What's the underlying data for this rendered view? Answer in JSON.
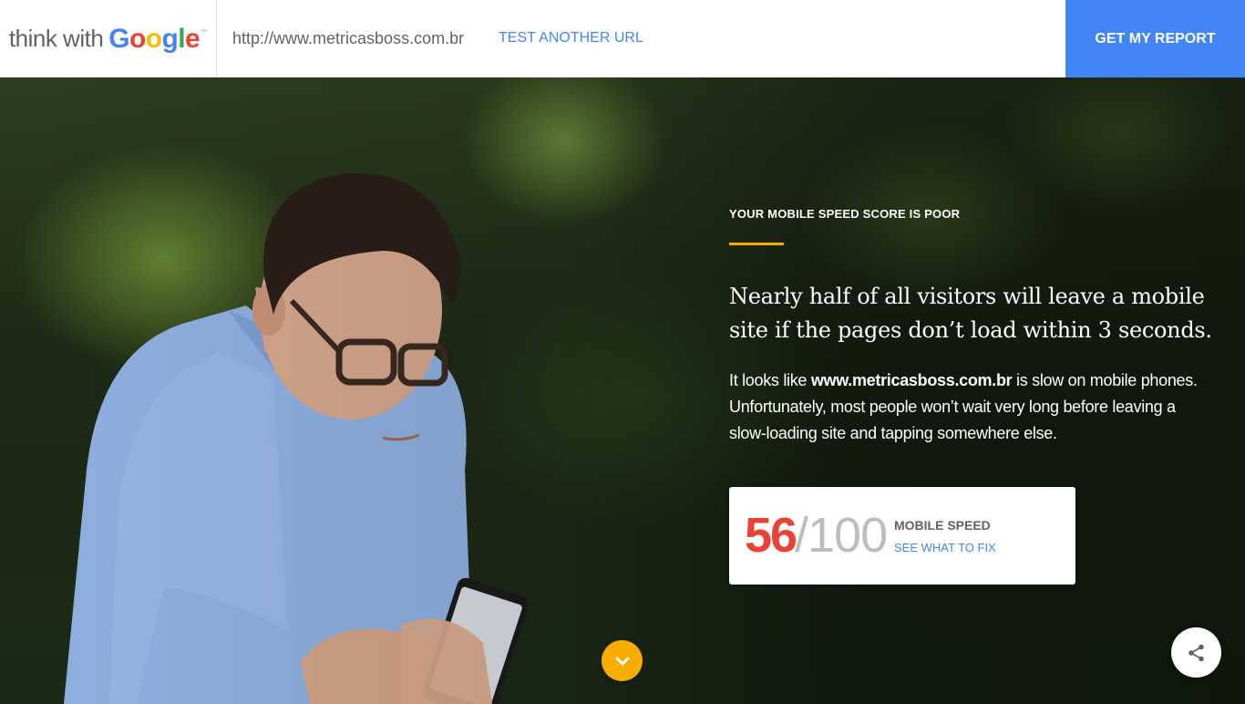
{
  "header": {
    "brand_prefix": "think with",
    "brand_letters": [
      "G",
      "o",
      "o",
      "g",
      "l",
      "e"
    ],
    "brand_colors": [
      "#4285f4",
      "#ea4335",
      "#fbbc05",
      "#4285f4",
      "#34a853",
      "#ea4335"
    ],
    "url": "http://www.metricasboss.com.br",
    "test_another_label": "TEST ANOTHER URL",
    "report_button_label": "GET MY REPORT"
  },
  "hero": {
    "eyebrow": "YOUR MOBILE SPEED SCORE IS POOR",
    "headline_line1": "Nearly half of all visitors will leave a mobile",
    "headline_line2": "site if the pages don’t load within 3 seconds.",
    "body_prefix": "It looks like ",
    "body_domain": "www.metricasboss.com.br",
    "body_suffix": " is slow on mobile phones. Unfortunately, most people won’t wait very long before leaving a slow-loading site and tapping somewhere else."
  },
  "score": {
    "value": "56",
    "max": "/100",
    "label": "MOBILE SPEED",
    "link_label": "SEE WHAT TO FIX"
  },
  "controls": {
    "scroll_icon": "chevron-down-icon",
    "share_icon": "share-icon"
  },
  "colors": {
    "accent_blue": "#4285f4",
    "score_red": "#ea4335",
    "accent_yellow": "#f9ab00"
  }
}
